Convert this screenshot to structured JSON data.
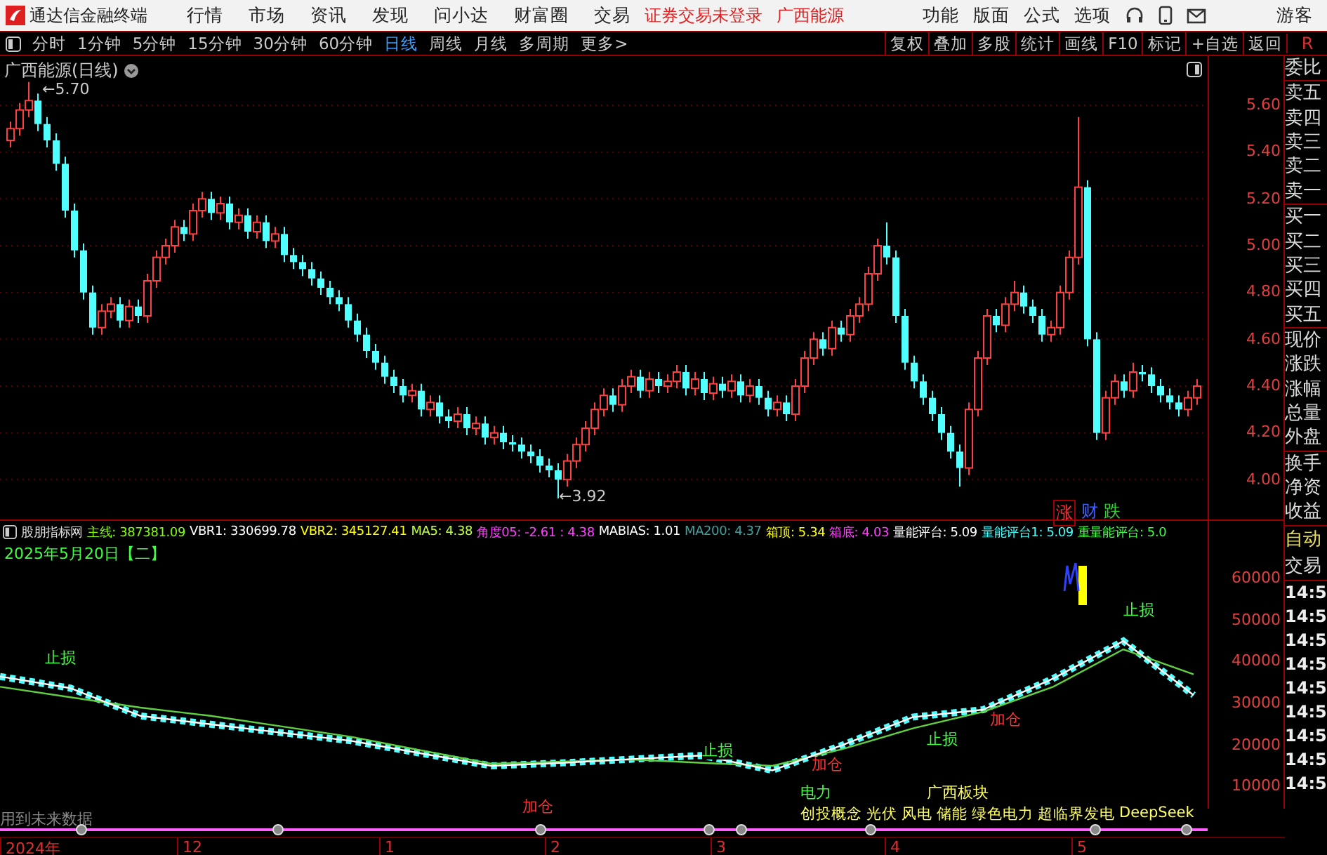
{
  "menu_bar": {
    "app_title": "通达信金融终端",
    "menu": [
      "行情",
      "市场",
      "资讯",
      "发现",
      "问小达",
      "财富圈",
      "交易"
    ],
    "login_status": "证券交易未登录",
    "stock_name": "广西能源",
    "right_menu": [
      "功能",
      "版面",
      "公式",
      "选项"
    ],
    "user": "游客"
  },
  "period_bar": {
    "periods": [
      {
        "label": "分时",
        "selected": false
      },
      {
        "label": "1分钟",
        "selected": false
      },
      {
        "label": "5分钟",
        "selected": false
      },
      {
        "label": "15分钟",
        "selected": false
      },
      {
        "label": "30分钟",
        "selected": false
      },
      {
        "label": "60分钟",
        "selected": false
      },
      {
        "label": "日线",
        "selected": true
      },
      {
        "label": "周线",
        "selected": false
      },
      {
        "label": "月线",
        "selected": false
      },
      {
        "label": "多周期",
        "selected": false
      },
      {
        "label": "更多>",
        "selected": false
      }
    ],
    "tools": [
      "复权",
      "叠加",
      "多股",
      "统计",
      "画线",
      "F10",
      "标记",
      "+自选",
      "返回"
    ],
    "corner": "R"
  },
  "price_chart": {
    "title": "广西能源(日线)",
    "high_label": "←5.70",
    "low_label": "←3.92",
    "chart_data": {
      "type": "candlestick",
      "ylim": [
        3.83,
        5.81
      ],
      "grid": true,
      "yticks": [
        {
          "value": 5.6,
          "label": "5.60"
        },
        {
          "value": 5.4,
          "label": "5.40"
        },
        {
          "value": 5.2,
          "label": "5.20"
        },
        {
          "value": 5.0,
          "label": "5.00"
        },
        {
          "value": 4.8,
          "label": "4.80"
        },
        {
          "value": 4.6,
          "label": "4.60"
        },
        {
          "value": 4.4,
          "label": "4.40"
        },
        {
          "value": 4.2,
          "label": "4.20"
        },
        {
          "value": 4.0,
          "label": "4.00"
        }
      ],
      "ohlc": [
        [
          5.45,
          5.53,
          5.42,
          5.5
        ],
        [
          5.5,
          5.61,
          5.47,
          5.58
        ],
        [
          5.58,
          5.7,
          5.55,
          5.62
        ],
        [
          5.62,
          5.65,
          5.49,
          5.52
        ],
        [
          5.52,
          5.55,
          5.42,
          5.45
        ],
        [
          5.45,
          5.48,
          5.32,
          5.35
        ],
        [
          5.35,
          5.38,
          5.12,
          5.15
        ],
        [
          5.15,
          5.18,
          4.95,
          4.98
        ],
        [
          4.98,
          5.01,
          4.77,
          4.8
        ],
        [
          4.8,
          4.83,
          4.62,
          4.65
        ],
        [
          4.65,
          4.75,
          4.62,
          4.72
        ],
        [
          4.72,
          4.78,
          4.69,
          4.75
        ],
        [
          4.75,
          4.78,
          4.65,
          4.68
        ],
        [
          4.68,
          4.77,
          4.65,
          4.74
        ],
        [
          4.74,
          4.77,
          4.67,
          4.7
        ],
        [
          4.7,
          4.88,
          4.67,
          4.85
        ],
        [
          4.85,
          4.98,
          4.82,
          4.95
        ],
        [
          4.95,
          5.03,
          4.92,
          5.0
        ],
        [
          5.0,
          5.11,
          4.97,
          5.08
        ],
        [
          5.08,
          5.11,
          5.02,
          5.05
        ],
        [
          5.05,
          5.18,
          5.02,
          5.15
        ],
        [
          5.15,
          5.23,
          5.12,
          5.2
        ],
        [
          5.2,
          5.23,
          5.11,
          5.14
        ],
        [
          5.14,
          5.21,
          5.11,
          5.18
        ],
        [
          5.18,
          5.21,
          5.07,
          5.1
        ],
        [
          5.1,
          5.16,
          5.07,
          5.13
        ],
        [
          5.13,
          5.16,
          5.03,
          5.06
        ],
        [
          5.06,
          5.13,
          5.03,
          5.1
        ],
        [
          5.1,
          5.13,
          4.99,
          5.02
        ],
        [
          5.02,
          5.08,
          4.99,
          5.05
        ],
        [
          5.05,
          5.08,
          4.93,
          4.96
        ],
        [
          4.96,
          4.99,
          4.9,
          4.93
        ],
        [
          4.93,
          4.96,
          4.87,
          4.9
        ],
        [
          4.9,
          4.93,
          4.83,
          4.86
        ],
        [
          4.86,
          4.89,
          4.79,
          4.82
        ],
        [
          4.82,
          4.85,
          4.75,
          4.78
        ],
        [
          4.78,
          4.81,
          4.72,
          4.75
        ],
        [
          4.75,
          4.78,
          4.65,
          4.68
        ],
        [
          4.68,
          4.71,
          4.59,
          4.62
        ],
        [
          4.62,
          4.65,
          4.52,
          4.55
        ],
        [
          4.55,
          4.58,
          4.47,
          4.5
        ],
        [
          4.5,
          4.53,
          4.41,
          4.44
        ],
        [
          4.44,
          4.47,
          4.37,
          4.4
        ],
        [
          4.4,
          4.43,
          4.33,
          4.36
        ],
        [
          4.36,
          4.41,
          4.33,
          4.38
        ],
        [
          4.38,
          4.41,
          4.27,
          4.3
        ],
        [
          4.3,
          4.36,
          4.27,
          4.33
        ],
        [
          4.33,
          4.36,
          4.24,
          4.27
        ],
        [
          4.27,
          4.3,
          4.22,
          4.25
        ],
        [
          4.25,
          4.31,
          4.22,
          4.28
        ],
        [
          4.28,
          4.31,
          4.19,
          4.22
        ],
        [
          4.22,
          4.27,
          4.19,
          4.24
        ],
        [
          4.24,
          4.27,
          4.15,
          4.18
        ],
        [
          4.18,
          4.23,
          4.15,
          4.2
        ],
        [
          4.2,
          4.23,
          4.13,
          4.16
        ],
        [
          4.16,
          4.19,
          4.12,
          4.15
        ],
        [
          4.15,
          4.18,
          4.09,
          4.12
        ],
        [
          4.12,
          4.15,
          4.07,
          4.1
        ],
        [
          4.1,
          4.13,
          4.03,
          4.06
        ],
        [
          4.06,
          4.09,
          4.01,
          4.04
        ],
        [
          4.04,
          4.07,
          3.92,
          4.0
        ],
        [
          4.0,
          4.11,
          3.97,
          4.08
        ],
        [
          4.08,
          4.18,
          4.05,
          4.15
        ],
        [
          4.15,
          4.25,
          4.12,
          4.22
        ],
        [
          4.22,
          4.33,
          4.19,
          4.3
        ],
        [
          4.3,
          4.39,
          4.27,
          4.36
        ],
        [
          4.36,
          4.39,
          4.29,
          4.32
        ],
        [
          4.32,
          4.43,
          4.29,
          4.4
        ],
        [
          4.4,
          4.47,
          4.37,
          4.44
        ],
        [
          4.44,
          4.47,
          4.35,
          4.38
        ],
        [
          4.38,
          4.46,
          4.35,
          4.43
        ],
        [
          4.43,
          4.46,
          4.37,
          4.4
        ],
        [
          4.4,
          4.45,
          4.37,
          4.42
        ],
        [
          4.42,
          4.49,
          4.39,
          4.46
        ],
        [
          4.46,
          4.49,
          4.36,
          4.39
        ],
        [
          4.39,
          4.46,
          4.36,
          4.43
        ],
        [
          4.43,
          4.46,
          4.34,
          4.37
        ],
        [
          4.37,
          4.44,
          4.34,
          4.41
        ],
        [
          4.41,
          4.44,
          4.35,
          4.38
        ],
        [
          4.38,
          4.45,
          4.35,
          4.42
        ],
        [
          4.42,
          4.45,
          4.33,
          4.36
        ],
        [
          4.36,
          4.43,
          4.33,
          4.4
        ],
        [
          4.4,
          4.43,
          4.32,
          4.35
        ],
        [
          4.35,
          4.38,
          4.27,
          4.3
        ],
        [
          4.3,
          4.36,
          4.27,
          4.33
        ],
        [
          4.33,
          4.36,
          4.25,
          4.28
        ],
        [
          4.28,
          4.43,
          4.25,
          4.4
        ],
        [
          4.4,
          4.55,
          4.37,
          4.52
        ],
        [
          4.52,
          4.63,
          4.49,
          4.6
        ],
        [
          4.6,
          4.63,
          4.53,
          4.56
        ],
        [
          4.56,
          4.68,
          4.53,
          4.65
        ],
        [
          4.65,
          4.68,
          4.59,
          4.62
        ],
        [
          4.62,
          4.73,
          4.59,
          4.7
        ],
        [
          4.7,
          4.78,
          4.67,
          4.75
        ],
        [
          4.75,
          4.91,
          4.72,
          4.88
        ],
        [
          4.88,
          5.03,
          4.85,
          5.0
        ],
        [
          5.0,
          5.1,
          4.92,
          4.95
        ],
        [
          4.95,
          4.98,
          4.67,
          4.7
        ],
        [
          4.7,
          4.73,
          4.47,
          4.5
        ],
        [
          4.5,
          4.53,
          4.39,
          4.42
        ],
        [
          4.42,
          4.45,
          4.32,
          4.35
        ],
        [
          4.35,
          4.38,
          4.25,
          4.28
        ],
        [
          4.28,
          4.31,
          4.17,
          4.2
        ],
        [
          4.2,
          4.23,
          4.09,
          4.12
        ],
        [
          4.12,
          4.15,
          3.97,
          4.05
        ],
        [
          4.05,
          4.33,
          4.02,
          4.3
        ],
        [
          4.3,
          4.55,
          4.27,
          4.52
        ],
        [
          4.52,
          4.73,
          4.49,
          4.7
        ],
        [
          4.7,
          4.73,
          4.63,
          4.66
        ],
        [
          4.66,
          4.78,
          4.63,
          4.75
        ],
        [
          4.75,
          4.85,
          4.72,
          4.8
        ],
        [
          4.8,
          4.83,
          4.71,
          4.74
        ],
        [
          4.74,
          4.77,
          4.67,
          4.7
        ],
        [
          4.7,
          4.73,
          4.59,
          4.62
        ],
        [
          4.62,
          4.68,
          4.59,
          4.65
        ],
        [
          4.65,
          4.83,
          4.62,
          4.8
        ],
        [
          4.8,
          4.98,
          4.77,
          4.95
        ],
        [
          4.95,
          5.55,
          4.92,
          5.25
        ],
        [
          5.25,
          5.28,
          4.57,
          4.6
        ],
        [
          4.6,
          4.63,
          4.17,
          4.2
        ],
        [
          4.2,
          4.38,
          4.17,
          4.35
        ],
        [
          4.35,
          4.45,
          4.32,
          4.42
        ],
        [
          4.42,
          4.45,
          4.35,
          4.38
        ],
        [
          4.38,
          4.5,
          4.35,
          4.46
        ],
        [
          4.46,
          4.49,
          4.42,
          4.45
        ],
        [
          4.45,
          4.48,
          4.37,
          4.4
        ],
        [
          4.4,
          4.43,
          4.33,
          4.36
        ],
        [
          4.36,
          4.39,
          4.3,
          4.33
        ],
        [
          4.33,
          4.36,
          4.27,
          4.3
        ],
        [
          4.3,
          4.38,
          4.27,
          4.35
        ],
        [
          4.35,
          4.43,
          4.32,
          4.4
        ]
      ]
    },
    "signals": [
      {
        "text": "涨",
        "color": "#ff3030"
      },
      {
        "text": "财",
        "color": "#4060ff"
      },
      {
        "text": "跌",
        "color": "#30d030"
      }
    ]
  },
  "indicator": {
    "name": "股朋指标网",
    "values": [
      {
        "label": "主线: 387381.09",
        "color": "#80ff00"
      },
      {
        "label": "VBR1: 330699.78",
        "color": "#ffffff"
      },
      {
        "label": "VBR2: 345127.41",
        "color": "#ffff00"
      },
      {
        "label": "MA5: 4.38",
        "color": "#c0ff40"
      },
      {
        "label": "角度05: -2.61 : 4.38",
        "color": "#ff40ff"
      },
      {
        "label": "MABIAS: 1.01",
        "color": "#ffffff"
      },
      {
        "label": "MA200: 4.37",
        "color": "#40a0a0"
      },
      {
        "label": "箱顶: 5.34",
        "color": "#ffff00"
      },
      {
        "label": "箱底: 4.03",
        "color": "#ff40ff"
      },
      {
        "label": "量能评台: 5.09",
        "color": "#ffffff"
      },
      {
        "label": "量能评台1: 5.09",
        "color": "#40ffff"
      },
      {
        "label": "重量能评台: 5.0",
        "color": "#40ff40"
      }
    ],
    "date": "2025年5月20日【二】",
    "chart_data": {
      "type": "line",
      "ylim": [
        4700,
        73900
      ],
      "yticks": [
        60000,
        50000,
        40000,
        30000,
        20000,
        10000
      ],
      "series": [
        {
          "color": "#ffffff",
          "values": [
            36500,
            33700,
            27000,
            25000,
            23000,
            21000,
            18000,
            15000,
            15700,
            16600,
            17500,
            13900,
            20000,
            26700,
            28500,
            36000,
            45000,
            32000
          ]
        },
        {
          "color": "#60d040",
          "values": [
            34000,
            31500,
            29000,
            27000,
            24500,
            22000,
            18700,
            15500,
            16000,
            16500,
            15700,
            15000,
            19000,
            24000,
            28000,
            34000,
            43000,
            37000
          ]
        }
      ]
    },
    "annotations": [
      {
        "text": "止损",
        "kind": "stop"
      },
      {
        "text": "加仓",
        "kind": "add"
      },
      {
        "text": "止损",
        "kind": "stop"
      },
      {
        "text": "加仓",
        "kind": "add"
      },
      {
        "text": "止损",
        "kind": "stop"
      },
      {
        "text": "加仓",
        "kind": "add"
      },
      {
        "text": "止损",
        "kind": "stop"
      }
    ],
    "sector": "电力",
    "board": "广西板块",
    "concepts": [
      "创投概念",
      "光伏",
      "风电",
      "储能",
      "绿色电力",
      "超临界发电",
      "DeepSeek"
    ],
    "warning": "用到未来数据"
  },
  "timeline": [
    "2024年",
    "12",
    "1",
    "2",
    "3",
    "4",
    "5"
  ],
  "quote_panel": {
    "groups": [
      [
        "委比"
      ],
      [
        "卖五",
        "卖四",
        "卖三",
        "卖二",
        "卖一"
      ],
      [
        "买一",
        "买二",
        "买三",
        "买四",
        "买五"
      ],
      [
        "现价",
        "涨跌",
        "涨幅",
        "总量",
        "外盘"
      ],
      [
        "换手",
        "净资",
        "收益"
      ]
    ],
    "tabs": [
      {
        "label": "自动",
        "selected": true
      },
      {
        "label": "交易",
        "selected": false
      }
    ],
    "times": [
      "14:5",
      "14:5",
      "14:5",
      "14:5",
      "14:5",
      "14:5",
      "14:5",
      "14:5",
      "14:5"
    ]
  }
}
